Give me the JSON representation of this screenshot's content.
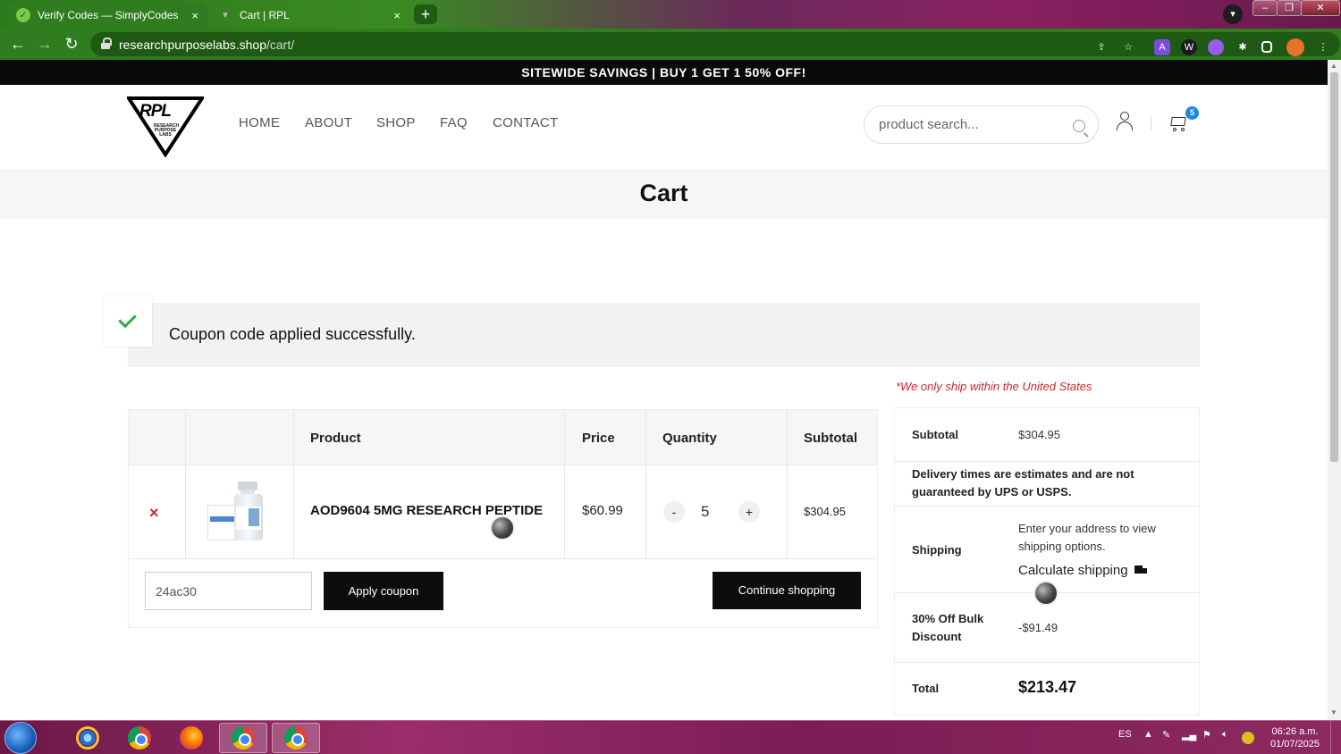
{
  "browser": {
    "tabs": [
      {
        "title": "Verify Codes — SimplyCodes",
        "active": true
      },
      {
        "title": "Cart | RPL",
        "active": false
      }
    ],
    "new_tab": "+",
    "close_glyph": "×",
    "url_host": "researchpurposelabs.shop",
    "url_path": "/cart/",
    "extensions": [
      "A",
      "W"
    ]
  },
  "site": {
    "promo_banner": "SITEWIDE SAVINGS | BUY 1 GET 1 50% OFF!",
    "logo_text": "RPL",
    "logo_sub": "RESEARCH PURPOSE LABS",
    "nav": [
      "HOME",
      "ABOUT",
      "SHOP",
      "FAQ",
      "CONTACT"
    ],
    "search_placeholder": "product search...",
    "cart_count": "5"
  },
  "cart": {
    "page_title": "Cart",
    "notice": "Coupon code applied successfully.",
    "ship_note": "*We only ship within the United States",
    "columns": [
      "Product",
      "Price",
      "Quantity",
      "Subtotal"
    ],
    "item": {
      "remove": "×",
      "name": "AOD9604 5MG RESEARCH PEPTIDE",
      "price": "$60.99",
      "qty_minus": "-",
      "quantity": "5",
      "qty_plus": "+",
      "subtotal": "$304.95"
    },
    "coupon_value": "24ac30",
    "apply_coupon": "Apply coupon",
    "continue_shopping": "Continue shopping"
  },
  "totals": {
    "subtotal_label": "Subtotal",
    "subtotal_value": "$304.95",
    "delivery_note": "Delivery times are estimates and are not guaranteed by UPS or USPS.",
    "shipping_label": "Shipping",
    "shipping_text": "Enter your address to view shipping options.",
    "calc_shipping": "Calculate shipping",
    "discount_label": "30% Off Bulk Discount",
    "discount_value": "-$91.49",
    "total_label": "Total",
    "total_value": "$213.47"
  },
  "taskbar": {
    "lang": "ES",
    "time": "06:26 a.m.",
    "date": "01/07/2025"
  },
  "colors": {
    "chrome_green": "#2f7d1f",
    "promo_bg": "#0a0a0a",
    "accent_red": "#d32424",
    "check_green": "#2eaa4a",
    "badge_blue": "#1e88e5"
  }
}
